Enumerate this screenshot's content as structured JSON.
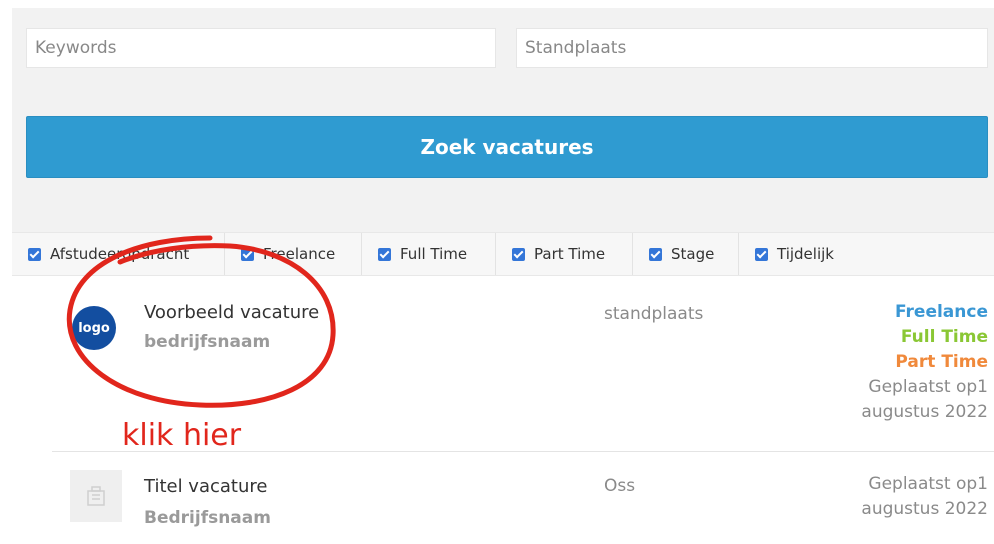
{
  "search": {
    "keywords_placeholder": "Keywords",
    "location_placeholder": "Standplaats",
    "submit_label": "Zoek vacatures",
    "accent_color": "#2f9bd1"
  },
  "filters": [
    {
      "label": "Afstudeeropdracht",
      "checked": true
    },
    {
      "label": "Freelance",
      "checked": true
    },
    {
      "label": "Full Time",
      "checked": true
    },
    {
      "label": "Part Time",
      "checked": true
    },
    {
      "label": "Stage",
      "checked": true
    },
    {
      "label": "Tijdelijk",
      "checked": true
    }
  ],
  "listings": [
    {
      "logo_text": "logo",
      "title": "Voorbeeld vacature",
      "company": "bedrijfsnaam",
      "location": "standplaats",
      "types": [
        "Freelance",
        "Full Time",
        "Part Time"
      ],
      "posted_line1": "Geplaatst op1",
      "posted_line2": "augustus 2022"
    },
    {
      "logo_icon": "building-placeholder-icon",
      "title": "Titel vacature",
      "company": "Bedrijfsnaam",
      "location": "Oss",
      "posted_line1": "Geplaatst op1",
      "posted_line2": "augustus 2022"
    }
  ],
  "annotation": {
    "text": "klik hier",
    "color": "#e1261c"
  },
  "type_colors": {
    "freelance": "#3a97d4",
    "full_time": "#8ac734",
    "part_time": "#f0893b"
  }
}
